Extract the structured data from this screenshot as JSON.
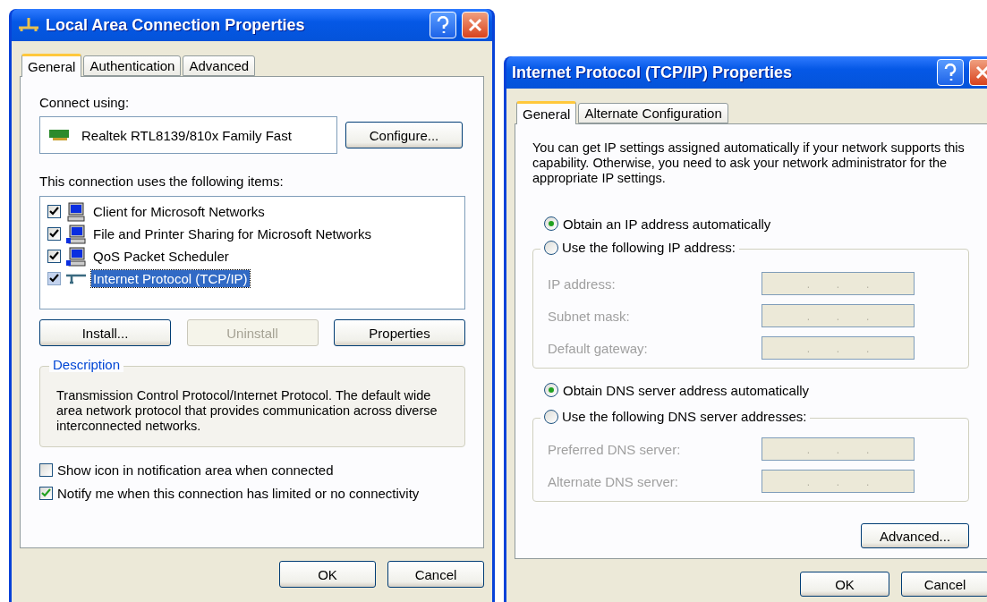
{
  "lan_properties": {
    "title": "Local Area Connection Properties",
    "tabs": [
      {
        "label": "General",
        "selected": true
      },
      {
        "label": "Authentication",
        "selected": false
      },
      {
        "label": "Advanced",
        "selected": false
      }
    ],
    "connect_using_label": "Connect using:",
    "adapter_name": "Realtek RTL8139/810x Family Fast",
    "configure_button": "Configure...",
    "items_label": "This connection uses the following items:",
    "components": [
      {
        "label": "Client for Microsoft Networks",
        "checked": true,
        "selected": false,
        "kind": "client"
      },
      {
        "label": "File and Printer Sharing for Microsoft Networks",
        "checked": true,
        "selected": false,
        "kind": "service"
      },
      {
        "label": "QoS Packet Scheduler",
        "checked": true,
        "selected": false,
        "kind": "service"
      },
      {
        "label": "Internet Protocol (TCP/IP)",
        "checked": true,
        "selected": true,
        "kind": "protocol"
      }
    ],
    "component_buttons": [
      {
        "label": "Install...",
        "disabled": false
      },
      {
        "label": "Uninstall",
        "disabled": true
      },
      {
        "label": "Properties",
        "disabled": false
      }
    ],
    "description": {
      "legend": "Description",
      "text": "Transmission Control Protocol/Internet Protocol. The default wide area network protocol that provides communication across diverse interconnected networks."
    },
    "options": [
      {
        "label": "Show icon in notification area when connected",
        "checked": false
      },
      {
        "label": "Notify me when this connection has limited or no connectivity",
        "checked": true
      }
    ],
    "footer_buttons": [
      "OK",
      "Cancel"
    ]
  },
  "tcpip_properties": {
    "title": "Internet Protocol (TCP/IP) Properties",
    "tabs": [
      {
        "label": "General",
        "selected": true
      },
      {
        "label": "Alternate Configuration",
        "selected": false
      }
    ],
    "intro": "You can get IP settings assigned automatically if your network supports this capability. Otherwise, you need to ask your network administrator for the appropriate IP settings.",
    "ip_choice": [
      {
        "label": "Obtain an IP address automatically",
        "selected": true
      },
      {
        "label": "Use the following IP address:",
        "selected": false
      }
    ],
    "ip_fields": [
      {
        "label": "IP address:",
        "disabled": true,
        "separator": "."
      },
      {
        "label": "Subnet mask:",
        "disabled": true,
        "separator": "."
      },
      {
        "label": "Default gateway:",
        "disabled": true,
        "separator": "."
      }
    ],
    "dns_choice": [
      {
        "label": "Obtain DNS server address automatically",
        "selected": true
      },
      {
        "label": "Use the following DNS server addresses:",
        "selected": false
      }
    ],
    "dns_fields": [
      {
        "label": "Preferred DNS server:",
        "disabled": true,
        "separator": "."
      },
      {
        "label": "Alternate DNS server:",
        "disabled": true,
        "separator": "."
      }
    ],
    "advanced_button": "Advanced...",
    "footer_buttons": [
      "OK",
      "Cancel"
    ]
  }
}
